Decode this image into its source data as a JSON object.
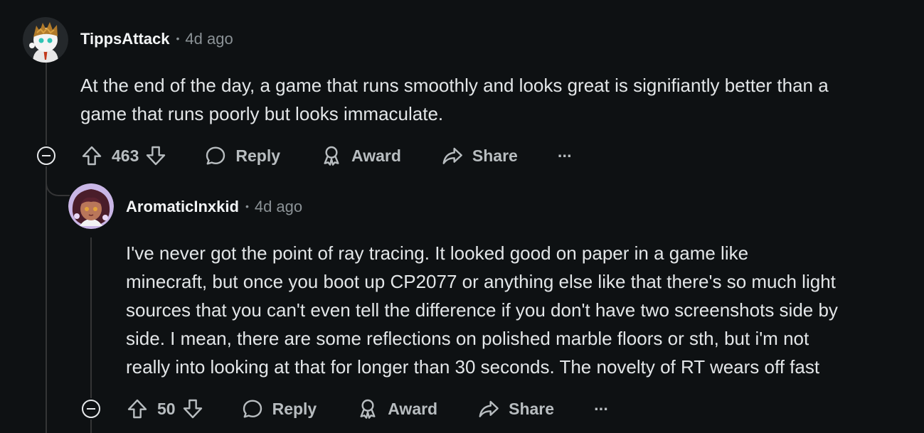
{
  "comments": [
    {
      "username": "TippsAttack",
      "time": "4d ago",
      "body_lines": [
        "At the end of the day, a game that runs smoothly and looks great is signifiantly better than a",
        "game that runs poorly but looks immaculate."
      ],
      "votes": "463",
      "reply_label": "Reply",
      "award_label": "Award",
      "share_label": "Share",
      "more_label": "···"
    },
    {
      "username": "AromaticInxkid",
      "time": "4d ago",
      "body_lines": [
        "I've never got the point of ray tracing. It looked good on paper in a game like",
        "minecraft, but once you boot up CP2077 or anything else like that there's so much light",
        "sources that you can't even tell the difference if you don't have two screenshots side by",
        "side. I mean, there are some reflections on polished marble floors or sth, but i'm not",
        "really into looking at that for longer than 30 seconds. The novelty of RT wears off fast"
      ],
      "votes": "50",
      "reply_label": "Reply",
      "award_label": "Award",
      "share_label": "Share",
      "more_label": "···"
    }
  ],
  "meta_separator": "•",
  "colors": {
    "background": "#0e1113",
    "text": "#e3e6e8",
    "muted": "#8b9296",
    "action": "#b8bdc0",
    "thread_line": "#343536"
  }
}
